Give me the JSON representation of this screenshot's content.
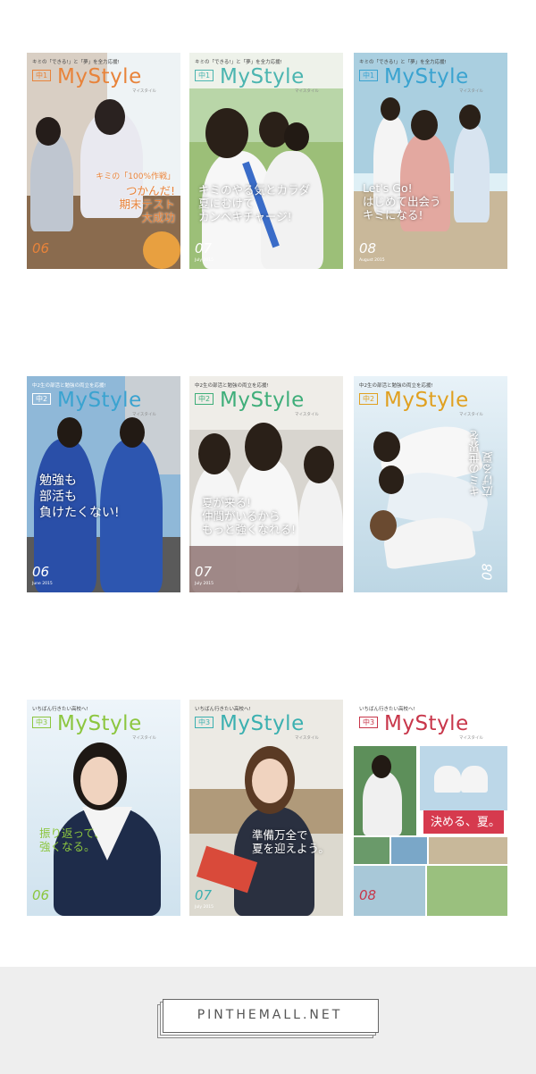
{
  "covers": [
    {
      "tagline": "キミの「できる!」と「夢」を全力応援!",
      "grade": "中1",
      "brand": "MyStyle",
      "subtitle": "マイスタイル",
      "headline": [
        "キミの「100%作戦」",
        "つかんだ!",
        "期末テスト",
        "大成功"
      ],
      "num": "06",
      "colors": {
        "brand": "#e8833a",
        "bg": "#d9cfc4",
        "accent": "#e8a040"
      }
    },
    {
      "tagline": "キミの「できる!」と「夢」を全力応援!",
      "grade": "中1",
      "brand": "MyStyle",
      "subtitle": "マイスタイル",
      "headline": [
        "キミのやる気とカラダ",
        "夏にむけて",
        "カンペキチャージ!"
      ],
      "num": "07",
      "month": "July 2015",
      "colors": {
        "brand": "#4bb5b0",
        "bg": "#9cbf78",
        "accent": "#ffffff"
      }
    },
    {
      "tagline": "キミの「できる!」と「夢」を全力応援!",
      "grade": "中1",
      "brand": "MyStyle",
      "subtitle": "マイスタイル",
      "headline": [
        "Let's Go!",
        "はじめて出会う",
        "キミになる!"
      ],
      "num": "08",
      "month": "August 2015",
      "colors": {
        "brand": "#3aa3d0",
        "bg": "#aacfe0",
        "accent": "#ffffff"
      }
    },
    {
      "tagline": "中2生の部活と勉強の両立を応援!",
      "grade": "中2",
      "brand": "MyStyle",
      "subtitle": "マイスタイル",
      "headline": [
        "勉強も",
        "部活も",
        "負けたくない!"
      ],
      "num": "06",
      "month": "June 2015",
      "colors": {
        "brand": "#3aa3d0",
        "bg": "#8fb8d8",
        "accent": "#ffffff"
      }
    },
    {
      "tagline": "中2生の部活と勉強の両立を応援!",
      "grade": "中2",
      "brand": "MyStyle",
      "subtitle": "マイスタイル",
      "headline": [
        "夏が来る!",
        "仲間がいるから",
        "もっと強くなれる!"
      ],
      "num": "07",
      "month": "July 2015",
      "colors": {
        "brand": "#3fae7a",
        "bg": "#d8d5cf",
        "accent": "#ffffff"
      }
    },
    {
      "tagline": "中2生の部活と勉強の両立を応援!",
      "grade": "中2",
      "brand": "MyStyle",
      "subtitle": "マイスタイル",
      "headline": [
        "キミの世界を",
        "広げる夏"
      ],
      "num": "08",
      "colors": {
        "brand": "#e0a020",
        "bg": "#bcd6e4",
        "accent": "#ffffff"
      }
    },
    {
      "tagline": "いちばん行きたい高校へ!",
      "grade": "中3",
      "brand": "MyStyle",
      "subtitle": "マイスタイル",
      "headline": [
        "振り返って、",
        "強くなる。"
      ],
      "num": "06",
      "colors": {
        "brand": "#8cc63f",
        "bg": "#cfe2ee",
        "accent": "#8cc63f"
      }
    },
    {
      "tagline": "いちばん行きたい高校へ!",
      "grade": "中3",
      "brand": "MyStyle",
      "subtitle": "マイスタイル",
      "headline": [
        "準備万全で",
        "夏を迎えよう。"
      ],
      "num": "07",
      "month": "July 2015",
      "colors": {
        "brand": "#3bb0b0",
        "bg": "#dcd9cf",
        "accent": "#ffffff"
      }
    },
    {
      "tagline": "いちばん行きたい高校へ!",
      "grade": "中3",
      "brand": "MyStyle",
      "subtitle": "マイスタイル",
      "headline": [
        "決める、夏。"
      ],
      "num": "08",
      "colors": {
        "brand": "#c8364a",
        "bg": "#ffffff",
        "accent": "#d63a4e"
      }
    }
  ],
  "footer": {
    "logo": "PINTHEMALL.NET"
  }
}
